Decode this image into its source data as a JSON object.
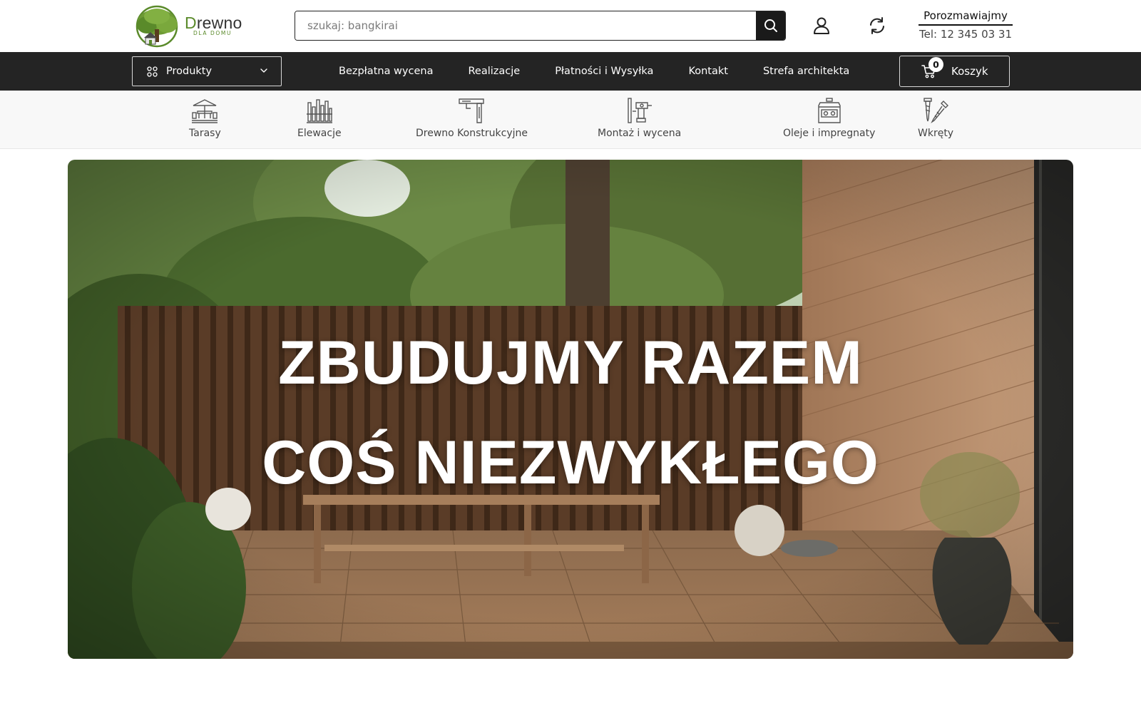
{
  "brand": {
    "name_first_letter": "D",
    "name_rest": "rewno",
    "subtitle": "DLA DOMU",
    "colors": {
      "green": "#5a8a2a",
      "dark": "#242424"
    }
  },
  "search": {
    "placeholder": "szukaj: bangkirai",
    "icon": "search-icon"
  },
  "header_icons": [
    "user-icon",
    "refresh-icon"
  ],
  "contact": {
    "title": "Porozmawiajmy",
    "phone": "Tel: 12 345 03 31"
  },
  "nav": {
    "products_label": "Produkty",
    "links": [
      {
        "label": "Bezpłatna wycena"
      },
      {
        "label": "Realizacje"
      },
      {
        "label": "Płatności i Wysyłka"
      },
      {
        "label": "Kontakt"
      },
      {
        "label": "Strefa architekta"
      }
    ],
    "cart": {
      "label": "Koszyk",
      "count": "0"
    }
  },
  "categories": [
    {
      "label": "Tarasy",
      "icon": "terrace-icon"
    },
    {
      "label": "Elewacje",
      "icon": "facade-icon"
    },
    {
      "label": "Drewno Konstrukcyjne",
      "icon": "beam-icon"
    },
    {
      "label": "Montaż i wycena",
      "icon": "drill-icon"
    },
    {
      "label": "Oleje i impregnaty",
      "icon": "oil-can-icon"
    },
    {
      "label": "Wkręty",
      "icon": "screw-icon"
    }
  ],
  "hero": {
    "line1": "ZBUDUJMY RAZEM",
    "line2": "COŚ NIEZWYKŁEGO"
  }
}
